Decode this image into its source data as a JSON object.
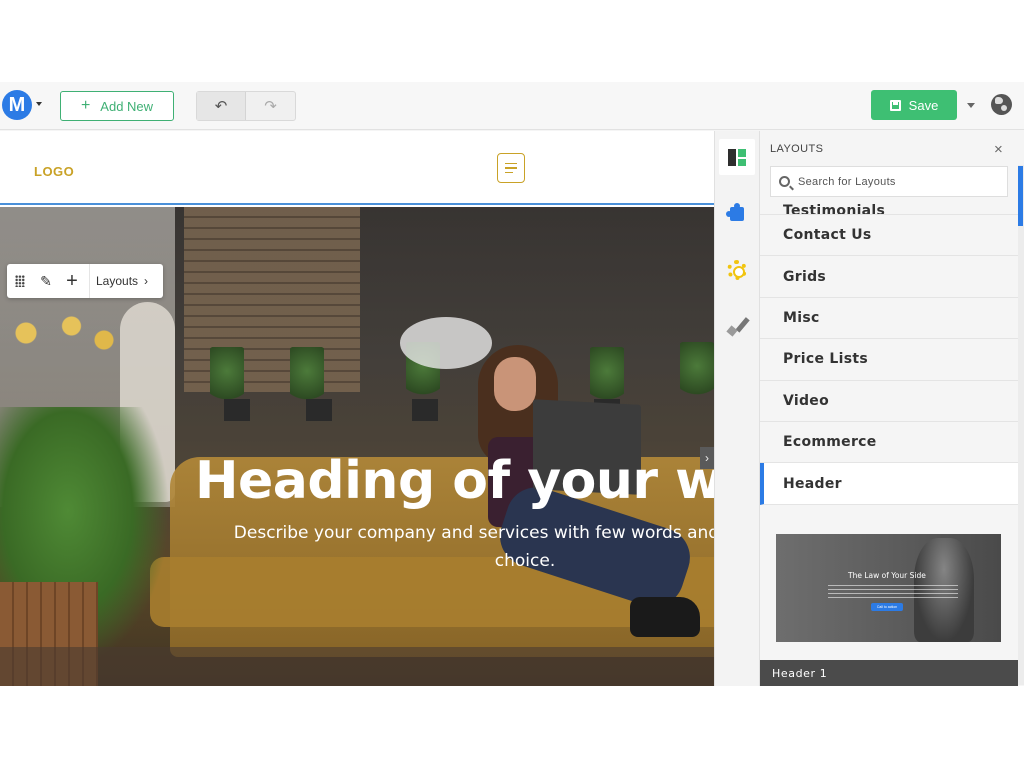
{
  "toolbar": {
    "brand_letter": "M",
    "add_new_label": "Add New",
    "undo_icon": "undo-icon",
    "redo_icon": "redo-icon",
    "save_label": "Save",
    "accent_green": "#3ebf73",
    "accent_blue": "#2c7be5"
  },
  "site": {
    "logo_text": "LOGO",
    "heading": "Heading of your web",
    "description": "Describe your company and services with few words and explain wh",
    "description_line2": "choice."
  },
  "element_toolbar": {
    "layouts_label": "Layouts",
    "chevron": "›"
  },
  "rail": {
    "items": [
      "layouts-icon",
      "puzzle-icon",
      "gear-icon",
      "brush-icon"
    ],
    "active": "layouts-icon"
  },
  "panel": {
    "title": "LAYOUTS",
    "close": "×",
    "search_placeholder": "Search for Layouts",
    "items": [
      {
        "label": "Testimonials"
      },
      {
        "label": "Contact Us"
      },
      {
        "label": "Grids"
      },
      {
        "label": "Misc"
      },
      {
        "label": "Price Lists"
      },
      {
        "label": "Video"
      },
      {
        "label": "Ecommerce"
      },
      {
        "label": "Header"
      }
    ],
    "active_item": "Header",
    "preview": {
      "title": "The Law of Your Side",
      "button": "Call to action",
      "label": "Header 1"
    }
  }
}
